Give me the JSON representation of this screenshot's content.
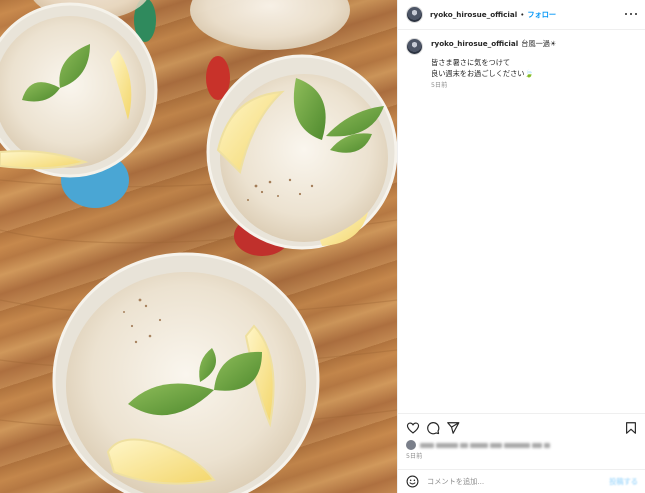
{
  "post": {
    "photo_alt": "",
    "header": {
      "username": "ryoko_hirosue_official",
      "separator": "•",
      "follow_label": "フォロー",
      "more_icon": "more-horizontal-icon"
    },
    "caption": {
      "username": "ryoko_hirosue_official",
      "title": "台風一過☀",
      "lines": [
        "皆さま暑さに気をつけて",
        "良い週末をお過ごしください🍃"
      ],
      "time": "5日前"
    },
    "actions": {
      "like_icon": "heart-icon",
      "comment_icon": "comment-icon",
      "share_icon": "send-icon",
      "save_icon": "bookmark-icon"
    },
    "date": "5日前",
    "comment_box": {
      "emoji_icon": "emoji-icon",
      "placeholder": "コメントを追加...",
      "value": "",
      "post_label": "投稿する"
    }
  },
  "colors": {
    "accent": "#0095f6",
    "text": "#262626",
    "muted": "#8e8e8e",
    "border": "#efefef"
  }
}
